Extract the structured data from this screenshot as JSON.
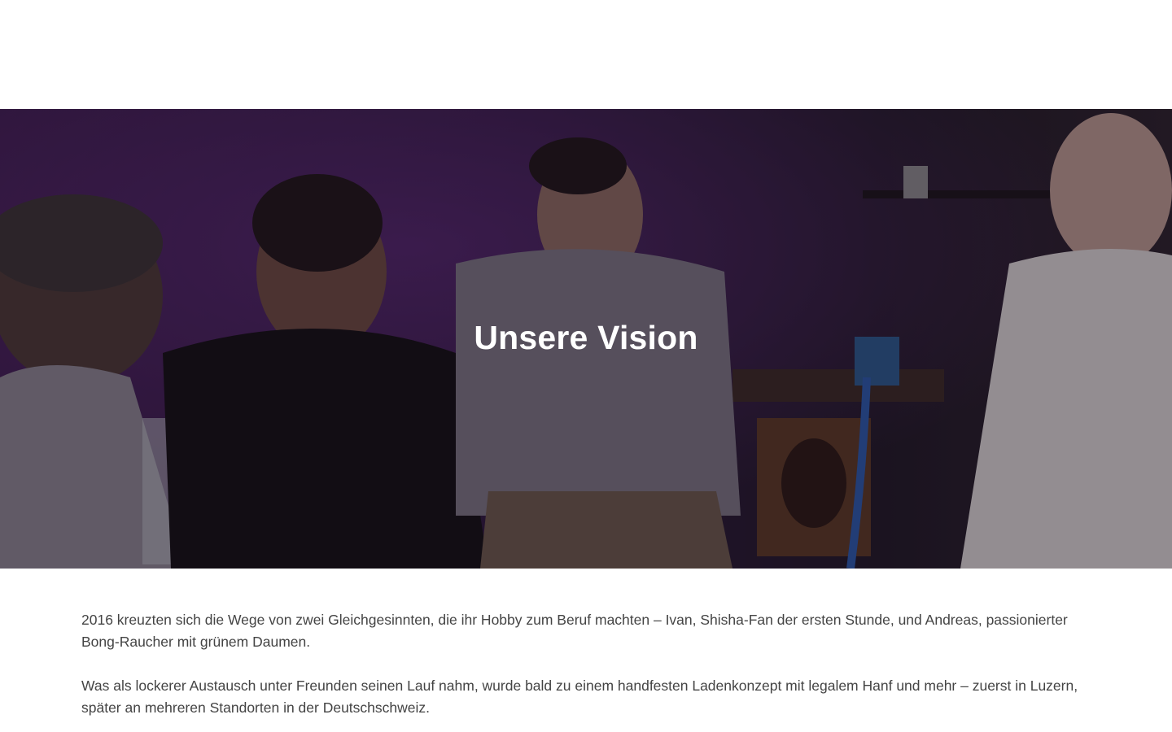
{
  "hero": {
    "title": "Unsere Vision",
    "image_label": "Group of four men smoking shisha and bongs in a dark purple room"
  },
  "content": {
    "paragraphs": [
      "2016 kreuzten sich die Wege von zwei Gleichgesinnten, die ihr Hobby zum Beruf machten – Ivan, Shisha-Fan der ersten Stunde, und Andreas, passionierter Bong-Raucher mit grünem Daumen.",
      "Was als lockerer Austausch unter Freunden seinen Lauf nahm, wurde bald zu einem handfesten Ladenkonzept mit legalem Hanf und mehr – zuerst in Luzern, später an mehreren Standorten in der Deutschschweiz."
    ]
  },
  "colors": {
    "hero_tint": "#2a1838",
    "text": "#444444",
    "title": "#ffffff"
  }
}
